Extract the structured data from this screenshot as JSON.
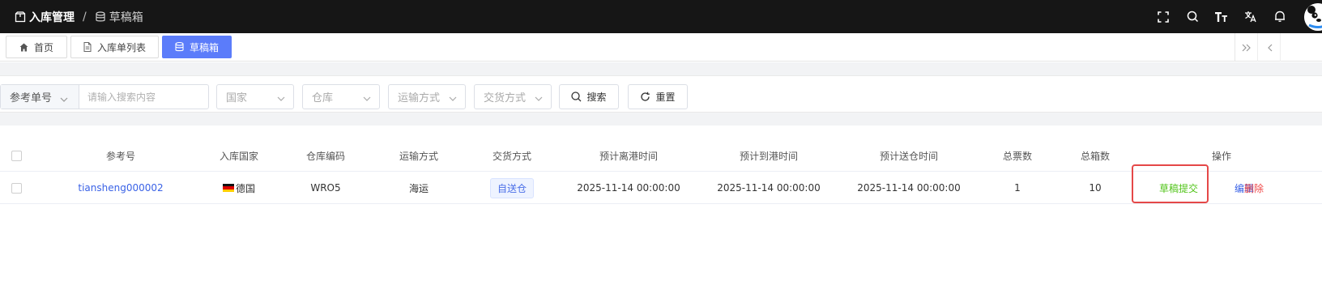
{
  "breadcrumb": {
    "parent": "入库管理",
    "separator": "/",
    "current": "草稿箱"
  },
  "top_icons": [
    "fullscreen-icon",
    "search-icon",
    "font-size-icon",
    "translate-icon",
    "bell-icon"
  ],
  "tabs": [
    {
      "label": "首页",
      "icon": "home-icon",
      "active": false
    },
    {
      "label": "入库单列表",
      "icon": "document-icon",
      "active": false
    },
    {
      "label": "草稿箱",
      "icon": "database-icon",
      "active": true
    }
  ],
  "filters": {
    "ref_select": "参考单号",
    "search_placeholder": "请输入搜索内容",
    "country_placeholder": "国家",
    "warehouse_placeholder": "仓库",
    "shipping_placeholder": "运输方式",
    "delivery_placeholder": "交货方式",
    "search_button": "搜索",
    "reset_button": "重置"
  },
  "table": {
    "headers": [
      "参考号",
      "入库国家",
      "仓库编码",
      "运输方式",
      "交货方式",
      "预计离港时间",
      "预计到港时间",
      "预计送仓时间",
      "总票数",
      "总箱数",
      "操作"
    ],
    "rows": [
      {
        "ref": "tiansheng000002",
        "country": "德国",
        "warehouse": "WRO5",
        "shipping": "海运",
        "delivery": "自送仓",
        "etd": "2025-11-14 00:00:00",
        "eta": "2025-11-14 00:00:00",
        "delivery_time": "2025-11-14 00:00:00",
        "tickets": "1",
        "boxes": "10",
        "actions": {
          "submit": "草稿提交",
          "edit": "编辑",
          "delete": "删除"
        }
      }
    ]
  },
  "colors": {
    "accent": "#5b7cfa",
    "topbar": "#161616",
    "link": "#3a62e6",
    "submit": "#52c41a",
    "delete": "#f04848",
    "highlight_box": "#e54848"
  }
}
